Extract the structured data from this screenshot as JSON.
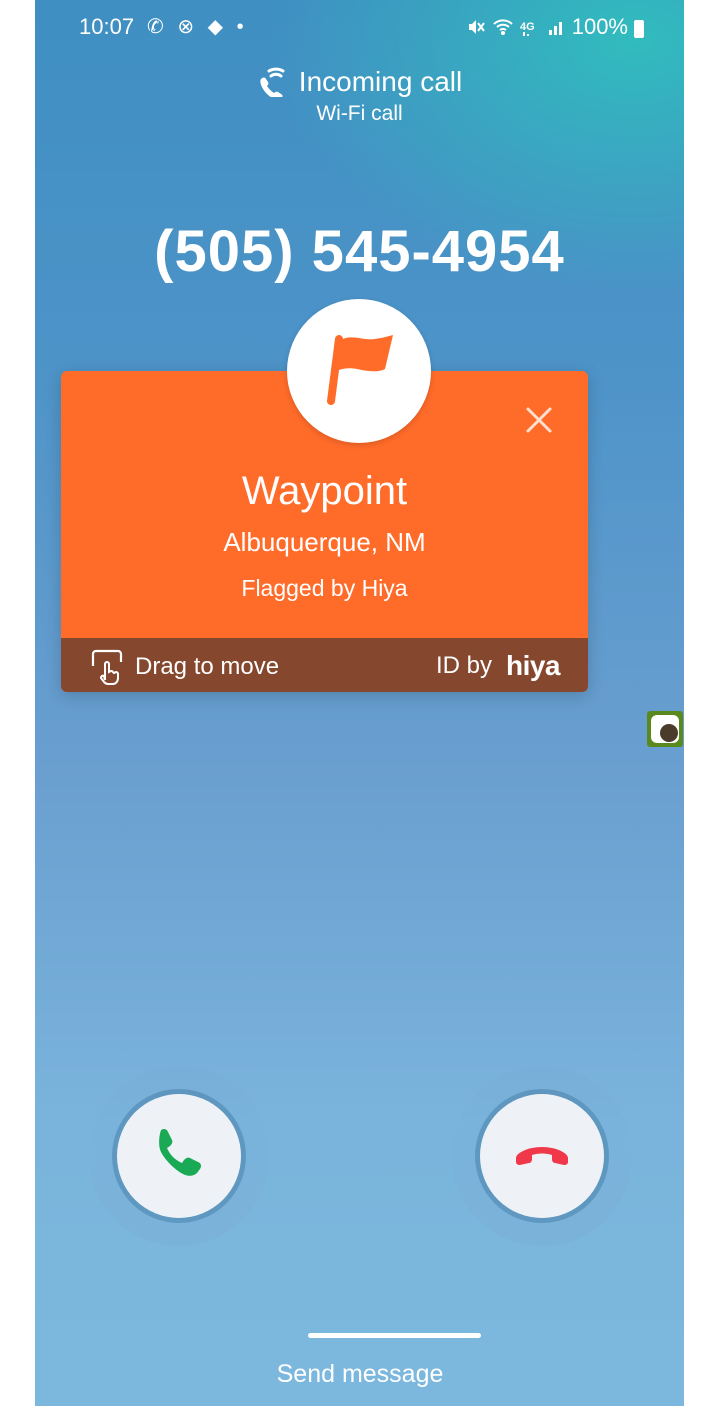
{
  "status_bar": {
    "time": "10:07",
    "left_icons": "✆ ⊗ ◆ •",
    "battery_pct": "100%"
  },
  "call": {
    "title": "Incoming call",
    "subtitle": "Wi-Fi call",
    "number": "(505) 545-4954"
  },
  "caller_card": {
    "name": "Waypoint",
    "location": "Albuquerque, NM",
    "flag_text": "Flagged by Hiya",
    "drag_text": "Drag to move",
    "id_by_text": "ID by",
    "brand": "hiya",
    "colors": {
      "card": "#ff6b29",
      "footer": "#85482f"
    }
  },
  "actions": {
    "send_message": "Send message",
    "answer_color": "#1aaa55",
    "decline_color": "#f0384a"
  }
}
